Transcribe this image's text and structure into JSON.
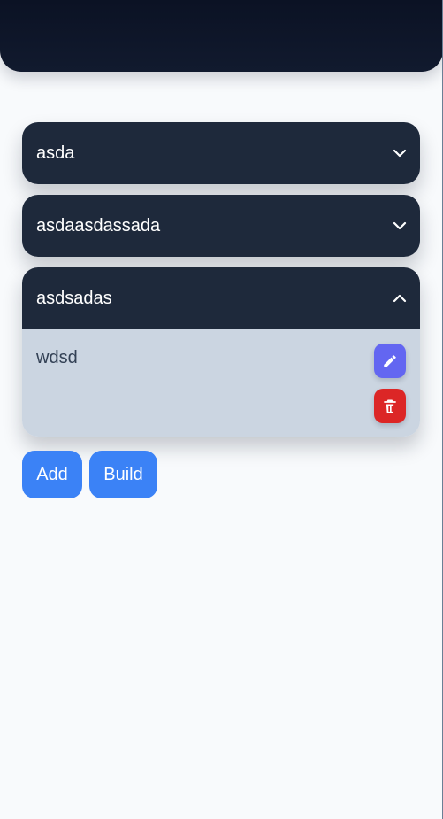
{
  "header": {},
  "accordions": [
    {
      "title": "asda",
      "expanded": false
    },
    {
      "title": "asdaasdassada",
      "expanded": false
    },
    {
      "title": "asdsadas",
      "expanded": true,
      "items": [
        {
          "text": "wdsd"
        }
      ]
    }
  ],
  "icons": {
    "collapsed": "chevron-down-icon",
    "expanded": "chevron-up-icon",
    "edit": "pencil-icon",
    "delete": "trash-icon"
  },
  "actions": {
    "add_label": "Add",
    "build_label": "Build"
  },
  "colors": {
    "background": "#f8fafc",
    "header": "#0f172a",
    "accordion": "#1e293b",
    "expanded_body": "#cbd5e1",
    "edit": "#6366f1",
    "delete": "#dc2626",
    "primary_button": "#3b82f6"
  }
}
